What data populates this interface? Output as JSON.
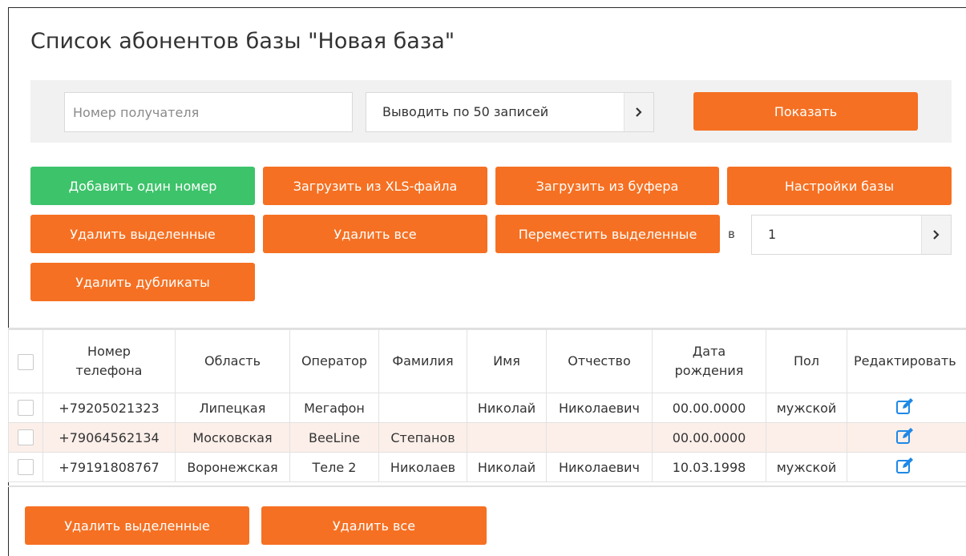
{
  "page": {
    "title": "Список абонентов базы \"Новая база\""
  },
  "filter": {
    "recipient_placeholder": "Номер получателя",
    "per_page_value": "Выводить по 50 записей",
    "show_label": "Показать"
  },
  "actions": {
    "add_one": "Добавить один номер",
    "upload_xls": "Загрузить из XLS-файла",
    "upload_buffer": "Загрузить из буфера",
    "base_settings": "Настройки базы",
    "delete_selected": "Удалить выделенные",
    "delete_all": "Удалить все",
    "move_selected": "Переместить выделенные",
    "move_to_label": "в",
    "move_target_value": "1",
    "delete_duplicates": "Удалить дубликаты"
  },
  "table": {
    "headers": {
      "phone": "Номер телефона",
      "region": "Область",
      "operator": "Оператор",
      "surname": "Фамилия",
      "name": "Имя",
      "patronymic": "Отчество",
      "birthdate": "Дата рождения",
      "gender": "Пол",
      "edit": "Редактировать"
    },
    "rows": [
      {
        "phone": "+79205021323",
        "region": "Липецкая",
        "operator": "Мегафон",
        "surname": "",
        "name": "Николай",
        "patronymic": "Николаевич",
        "birthdate": "00.00.0000",
        "gender": "мужской"
      },
      {
        "phone": "+79064562134",
        "region": "Московская",
        "operator": "BeeLine",
        "surname": "Степанов",
        "name": "",
        "patronymic": "",
        "birthdate": "00.00.0000",
        "gender": ""
      },
      {
        "phone": "+79191808767",
        "region": "Воронежская",
        "operator": "Теле 2",
        "surname": "Николаев",
        "name": "Николай",
        "patronymic": "Николаевич",
        "birthdate": "10.03.1998",
        "gender": "мужской"
      }
    ]
  },
  "bottom": {
    "delete_selected": "Удалить выделенные",
    "delete_all": "Удалить все"
  },
  "colors": {
    "accent": "#f57022",
    "success": "#3dc36a",
    "row_highlight": "#fcefe9",
    "edit_icon": "#1e88e5"
  },
  "icons": {
    "select_arrow": "chevron-right-icon",
    "edit": "edit-pencil-icon"
  }
}
